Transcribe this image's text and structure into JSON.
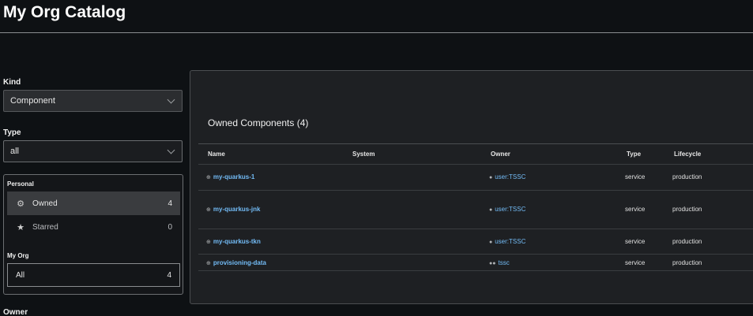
{
  "header": {
    "title": "My Org Catalog"
  },
  "filters": {
    "kind_label": "Kind",
    "kind_value": "Component",
    "type_label": "Type",
    "type_value": "all",
    "owner_label": "Owner"
  },
  "user_filter": {
    "personal_label": "Personal",
    "owned_label": "Owned",
    "owned_count": "4",
    "starred_label": "Starred",
    "starred_count": "0",
    "myorg_label": "My Org",
    "all_label": "All",
    "all_count": "4"
  },
  "table": {
    "title": "Owned Components (4)",
    "columns": [
      "Name",
      "System",
      "Owner",
      "Type",
      "Lifecycle"
    ],
    "rows": [
      {
        "name": "my-quarkus-1",
        "system": "",
        "owner": "user:TSSC",
        "owner_kind": "user",
        "type": "service",
        "lifecycle": "production"
      },
      {
        "name": "my-quarkus-jnk",
        "system": "",
        "owner": "user:TSSC",
        "owner_kind": "user",
        "type": "service",
        "lifecycle": "production"
      },
      {
        "name": "my-quarkus-tkn",
        "system": "",
        "owner": "user:TSSC",
        "owner_kind": "user",
        "type": "service",
        "lifecycle": "production"
      },
      {
        "name": "provisioning-data",
        "system": "",
        "owner": "tssc",
        "owner_kind": "group",
        "type": "service",
        "lifecycle": "production"
      }
    ]
  },
  "icons": {
    "owned": "gear-icon",
    "starred": "star-icon",
    "entity": "component-icon",
    "user": "user-icon",
    "group": "group-icon"
  },
  "colors": {
    "link": "#73bcf7",
    "background": "#0e1114",
    "card": "#1e2023"
  }
}
